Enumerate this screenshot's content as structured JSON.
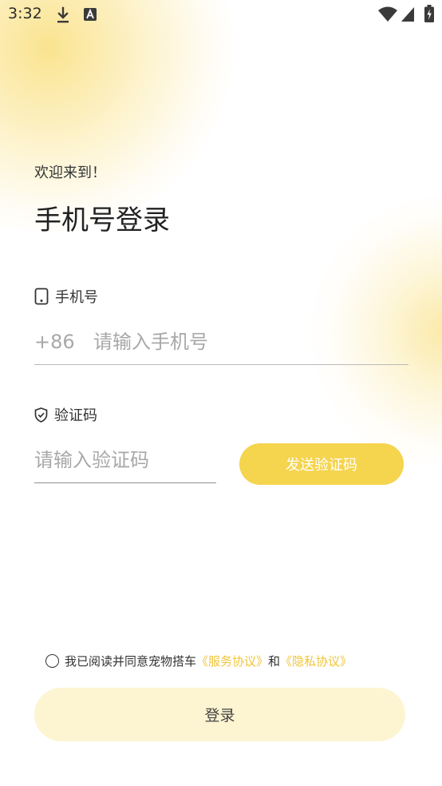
{
  "status_bar": {
    "time": "3:32",
    "icons": [
      "download-icon",
      "a-text-icon",
      "wifi-icon",
      "signal-icon",
      "battery-icon"
    ]
  },
  "header": {
    "welcome": "欢迎来到！",
    "title": "手机号登录"
  },
  "phone": {
    "label": "手机号",
    "country_code": "+86",
    "placeholder": "请输入手机号",
    "value": ""
  },
  "code": {
    "label": "验证码",
    "placeholder": "请输入验证码",
    "value": "",
    "send_button": "发送验证码"
  },
  "agreement": {
    "checked": false,
    "text": "我已阅读并同意宠物搭车",
    "service_link": "《服务协议》",
    "and": "和",
    "privacy_link": "《隐私协议》"
  },
  "login_button": "登录",
  "colors": {
    "accent": "#f5d44e",
    "link": "#f0c53a",
    "login_bg": "#fdf4d2"
  }
}
